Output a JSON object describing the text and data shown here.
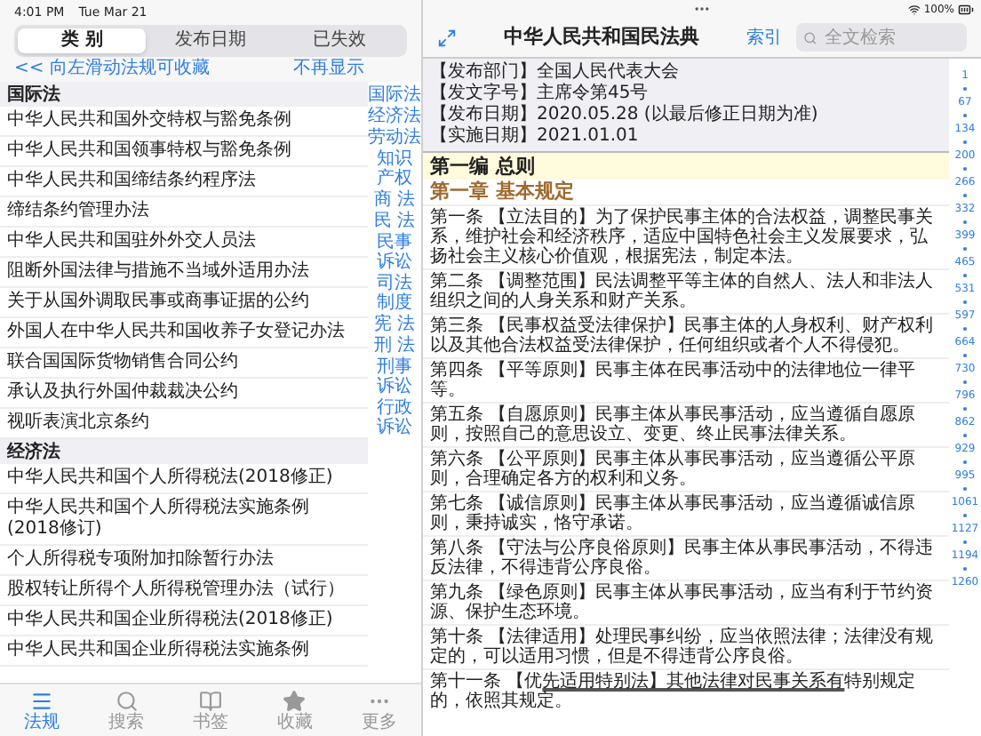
{
  "status_bar": {
    "time": "4:01 PM",
    "date": "Tue Mar 21",
    "battery": "100%"
  },
  "left": {
    "segments": [
      {
        "label": "类 别",
        "selected": true
      },
      {
        "label": "发布日期",
        "selected": false
      },
      {
        "label": "已失效",
        "selected": false
      }
    ],
    "hint": {
      "text": "<< 向左滑动法规可收藏",
      "dismiss": "不再显示"
    },
    "sections": [
      {
        "title": "国际法",
        "items": [
          "中华人民共和国外交特权与豁免条例",
          "中华人民共和国领事特权与豁免条例",
          "中华人民共和国缔结条约程序法",
          "缔结条约管理办法",
          "中华人民共和国驻外外交人员法",
          "阻断外国法律与措施不当域外适用办法",
          "关于从国外调取民事或商事证据的公约",
          "外国人在中华人民共和国收养子女登记办法",
          "联合国国际货物销售合同公约",
          "承认及执行外国仲裁裁决公约",
          "视听表演北京条约"
        ]
      },
      {
        "title": "经济法",
        "items": [
          "中华人民共和国个人所得税法(2018修正)",
          "中华人民共和国个人所得税法实施条例(2018修订)",
          "个人所得税专项附加扣除暂行办法",
          "股权转让所得个人所得税管理办法（试行）",
          "中华人民共和国企业所得税法(2018修正)",
          "中华人民共和国企业所得税法实施条例"
        ]
      }
    ],
    "categories": [
      "国际法",
      "经济法",
      "劳动法",
      "知识产权",
      "商 法",
      "民 法",
      "民事诉讼",
      "司法制度",
      "宪 法",
      "刑 法",
      "刑事诉讼",
      "行政诉讼"
    ]
  },
  "tab_bar": [
    {
      "label": "法规",
      "selected": true
    },
    {
      "label": "搜索",
      "selected": false
    },
    {
      "label": "书签",
      "selected": false
    },
    {
      "label": "收藏",
      "selected": false
    },
    {
      "label": "更多",
      "selected": false
    }
  ],
  "document": {
    "title": "中华人民共和国民法典",
    "index_link": "索引",
    "search": {
      "placeholder": "全文检索"
    },
    "meta": [
      "【发布部门】全国人民代表大会",
      "【发文字号】主席令第45号",
      "【发布日期】2020.05.28 (以最后修正日期为准)",
      "【实施日期】2021.01.01"
    ],
    "part_heading": "第一编 总则",
    "chapter_heading": "第一章 基本规定",
    "articles": [
      {
        "kind": "plain",
        "text": "第一条 【立法目的】为了保护民事主体的合法权益，调整民事关系，维护社会和经济秩序，适应中国特色社会主义发展要求，弘扬社会主义核心价值观，根据宪法，制定本法。"
      },
      {
        "kind": "plain",
        "text": "第二条 【调整范围】民法调整平等主体的自然人、法人和非法人组织之间的人身关系和财产关系。"
      },
      {
        "kind": "plain",
        "text": "第三条 【民事权益受法律保护】民事主体的人身权利、财产权利以及其他合法权益受法律保护，任何组织或者个人不得侵犯。"
      },
      {
        "kind": "plain",
        "text": "第四条 【平等原则】民事主体在民事活动中的法律地位一律平等。"
      },
      {
        "kind": "plain",
        "text": "第五条 【自愿原则】民事主体从事民事活动，应当遵循自愿原则，按照自己的意思设立、变更、终止民事法律关系。"
      },
      {
        "kind": "plain",
        "text": "第六条 【公平原则】民事主体从事民事活动，应当遵循公平原则，合理确定各方的权利和义务。"
      },
      {
        "kind": "plain",
        "text": "第七条 【诚信原则】民事主体从事民事活动，应当遵循诚信原则，秉持诚实，恪守承诺。"
      },
      {
        "kind": "plain",
        "text": "第八条 【守法与公序良俗原则】民事主体从事民事活动，不得违反法律，不得违背公序良俗。"
      },
      {
        "kind": "plain",
        "text": "第九条 【绿色原则】民事主体从事民事活动，应当有利于节约资源、保护生态环境。"
      },
      {
        "kind": "plain",
        "text": "第十条 【法律适用】处理民事纠纷，应当依照法律；法律没有规定的，可以适用习惯，但是不得违背公序良俗。"
      },
      {
        "kind": "marked",
        "segments": [
          {
            "text": "第十一条 【优",
            "underlined": false
          },
          {
            "text": "先适用特别法】其他法律对民事关系有",
            "underlined": true
          },
          {
            "text": "特别规定的，依照其规定。",
            "underlined": false
          }
        ]
      }
    ],
    "line_index": [
      "1",
      "67",
      "134",
      "200",
      "266",
      "332",
      "399",
      "465",
      "531",
      "597",
      "664",
      "730",
      "796",
      "862",
      "929",
      "995",
      "1061",
      "1127",
      "1194",
      "1260"
    ]
  }
}
